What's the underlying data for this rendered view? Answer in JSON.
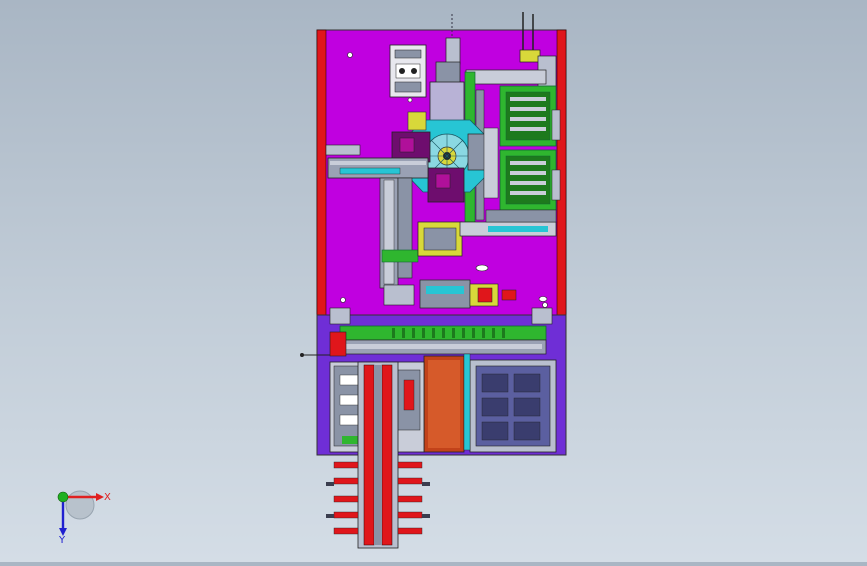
{
  "viewport": {
    "background_top": "#a9b6c4",
    "background_bottom": "#d4dde6"
  },
  "colors": {
    "upper_plate": "#c000e0",
    "lower_plate": "#6f2ed6",
    "frame_rail": "#e0161b",
    "conveyor": "#2fb62f",
    "chute": "#c2421a",
    "tray": "#5b5fa0",
    "mechanism_gray": "#8a93a6",
    "accent_cyan": "#27c5d4",
    "accent_yellow": "#d8d83a"
  },
  "triad": {
    "x_label": "X",
    "y_label": "Y",
    "x_color": "#e02020",
    "y_color": "#2020d0",
    "origin_color": "#20b020"
  }
}
